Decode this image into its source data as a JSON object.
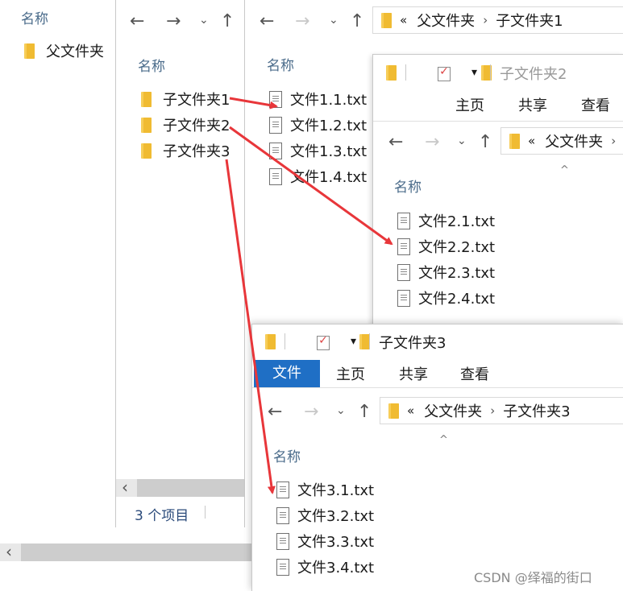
{
  "win_parent": {
    "column_header": "名称",
    "items": [
      {
        "label": "父文件夹",
        "icon": "folder-icon"
      }
    ],
    "scroll_left": "‹"
  },
  "win_a": {
    "nav": {
      "back": "←",
      "forward": "→",
      "recent": "⌄",
      "up": "↑"
    },
    "column_header": "名称",
    "items": [
      {
        "label": "子文件夹1",
        "icon": "folder-icon"
      },
      {
        "label": "子文件夹2",
        "icon": "folder-icon"
      },
      {
        "label": "子文件夹3",
        "icon": "folder-icon"
      }
    ],
    "status": "3 个项目",
    "scroll_left": "‹"
  },
  "win_sub1": {
    "nav": {
      "back": "←",
      "forward": "→",
      "recent": "⌄",
      "up": "↑"
    },
    "address": {
      "overflow": "«",
      "parent": "父文件夹",
      "sep": "›",
      "current": "子文件夹1"
    },
    "column_header": "名称",
    "items": [
      {
        "label": "文件1.1.txt",
        "icon": "text-file-icon"
      },
      {
        "label": "文件1.2.txt",
        "icon": "text-file-icon"
      },
      {
        "label": "文件1.3.txt",
        "icon": "text-file-icon"
      },
      {
        "label": "文件1.4.txt",
        "icon": "text-file-icon"
      }
    ]
  },
  "win_sub2": {
    "title": "子文件夹2",
    "qa_dropdown": "▾",
    "ribbon": {
      "home": "主页",
      "share": "共享",
      "view": "查看"
    },
    "nav": {
      "back": "←",
      "forward": "→",
      "recent": "⌄",
      "up": "↑"
    },
    "address": {
      "overflow": "«",
      "parent": "父文件夹",
      "sep": "›"
    },
    "sort_caret": "^",
    "column_header": "名称",
    "items": [
      {
        "label": "文件2.1.txt",
        "icon": "text-file-icon"
      },
      {
        "label": "文件2.2.txt",
        "icon": "text-file-icon"
      },
      {
        "label": "文件2.3.txt",
        "icon": "text-file-icon"
      },
      {
        "label": "文件2.4.txt",
        "icon": "text-file-icon"
      }
    ]
  },
  "win_sub3": {
    "title": "子文件夹3",
    "qa_dropdown": "▾",
    "ribbon": {
      "file": "文件",
      "home": "主页",
      "share": "共享",
      "view": "查看"
    },
    "nav": {
      "back": "←",
      "forward": "→",
      "recent": "⌄",
      "up": "↑"
    },
    "address": {
      "overflow": "«",
      "parent": "父文件夹",
      "sep": "›",
      "current": "子文件夹3"
    },
    "sort_caret": "^",
    "column_header": "名称",
    "items": [
      {
        "label": "文件3.1.txt",
        "icon": "text-file-icon"
      },
      {
        "label": "文件3.2.txt",
        "icon": "text-file-icon"
      },
      {
        "label": "文件3.3.txt",
        "icon": "text-file-icon"
      },
      {
        "label": "文件3.4.txt",
        "icon": "text-file-icon"
      }
    ]
  },
  "watermark": "CSDN @绎福的街口",
  "colors": {
    "arrow": "#e8363a",
    "ribbon_active": "#1f6fc5",
    "header_text": "#4a6b8a"
  }
}
